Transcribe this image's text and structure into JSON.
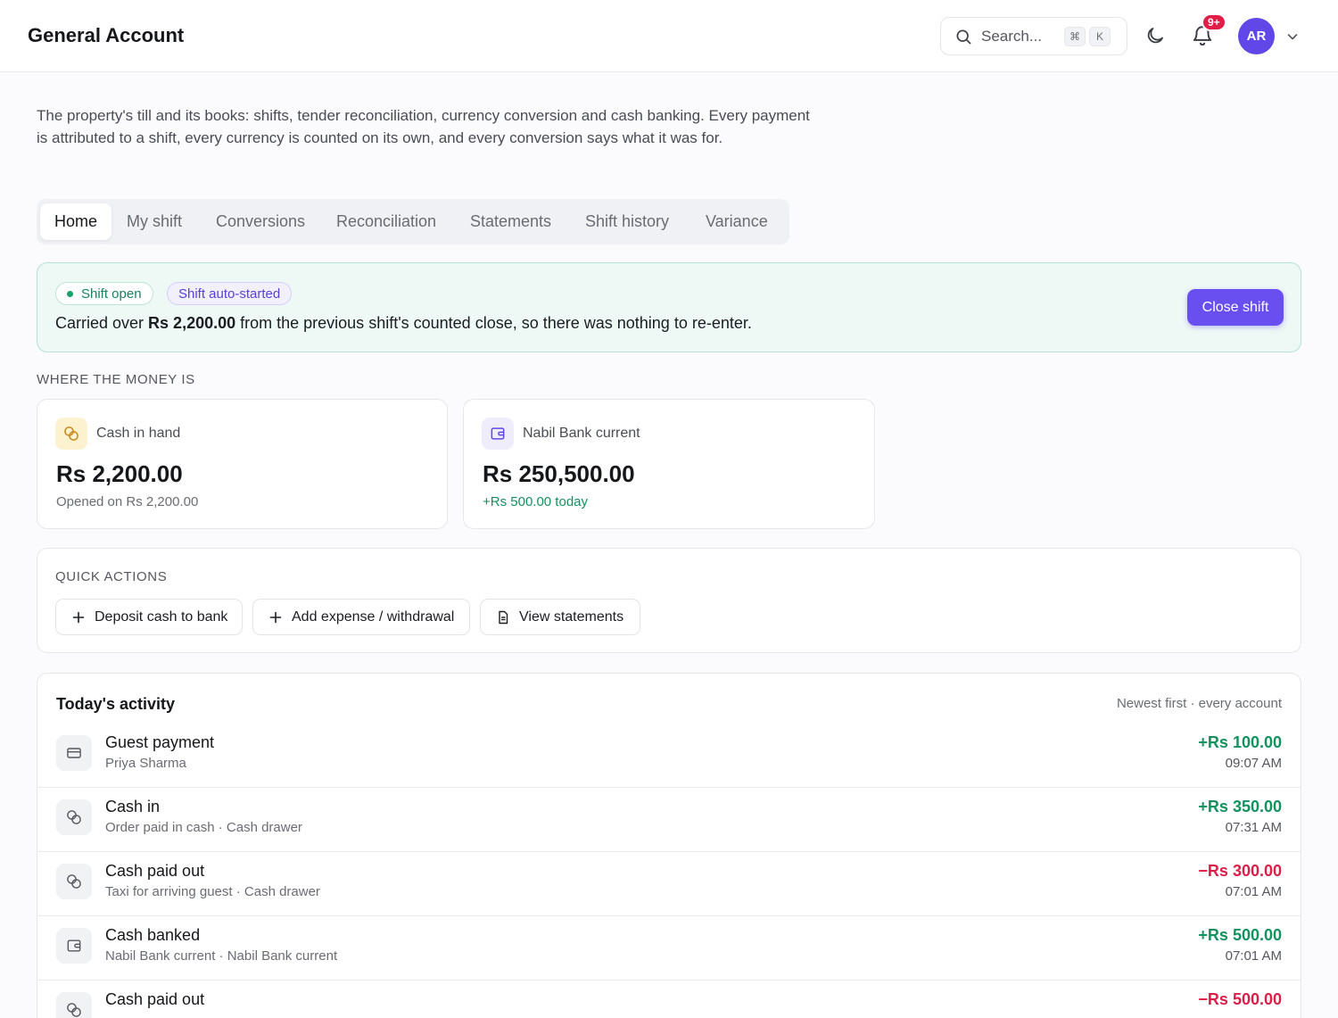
{
  "header": {
    "title": "General Account",
    "search_placeholder": "Search...",
    "shortcut_cmd": "⌘",
    "shortcut_key": "K",
    "notification_count": "9+",
    "avatar_initials": "AR"
  },
  "description": "The property's till and its books: shifts, tender reconciliation, currency conversion and cash banking. Every payment is attributed to a shift, every currency is counted on its own, and every conversion says what it was for.",
  "tabs": [
    {
      "label": "Home",
      "active": true
    },
    {
      "label": "My shift"
    },
    {
      "label": "Conversions"
    },
    {
      "label": "Reconciliation"
    },
    {
      "label": "Statements"
    },
    {
      "label": "Shift history"
    },
    {
      "label": "Variance"
    }
  ],
  "shift_banner": {
    "status_pill": "Shift open",
    "auto_pill": "Shift auto-started",
    "text_before": "Carried over ",
    "amount": "Rs 2,200.00",
    "text_after": " from the previous shift's counted close, so there was nothing to re-enter.",
    "close_button": "Close shift"
  },
  "money": {
    "section_label": "WHERE THE MONEY IS",
    "cash": {
      "label": "Cash in hand",
      "amount": "Rs 2,200.00",
      "sub": "Opened on Rs 2,200.00"
    },
    "bank": {
      "label": "Nabil Bank current",
      "amount": "Rs 250,500.00",
      "sub": "+Rs 500.00 today"
    }
  },
  "quick_actions": {
    "section_label": "QUICK ACTIONS",
    "deposit": "Deposit cash to bank",
    "expense": "Add expense / withdrawal",
    "statements": "View statements"
  },
  "activity": {
    "title": "Today's activity",
    "meta": "Newest first · every account",
    "rows": [
      {
        "icon": "card-icon",
        "title": "Guest payment",
        "sub": "Priya Sharma",
        "amount": "+Rs 100.00",
        "time": "09:07 AM",
        "sign": "pos"
      },
      {
        "icon": "coins-icon",
        "title": "Cash in",
        "sub": "Order paid in cash · Cash drawer",
        "amount": "+Rs 350.00",
        "time": "07:31 AM",
        "sign": "pos"
      },
      {
        "icon": "coins-icon",
        "title": "Cash paid out",
        "sub": "Taxi for arriving guest · Cash drawer",
        "amount": "−Rs 300.00",
        "time": "07:01 AM",
        "sign": "neg"
      },
      {
        "icon": "wallet-icon",
        "title": "Cash banked",
        "sub": "Nabil Bank current · Nabil Bank current",
        "amount": "+Rs 500.00",
        "time": "07:01 AM",
        "sign": "pos"
      },
      {
        "icon": "coins-icon",
        "title": "Cash paid out",
        "sub": "",
        "amount": "−Rs 500.00",
        "time": "",
        "sign": "neg"
      }
    ]
  },
  "colors": {
    "accent": "#6a4ff0",
    "positive": "#12925e",
    "negative": "#dc1f48",
    "banner_bg": "#eef8f5"
  }
}
